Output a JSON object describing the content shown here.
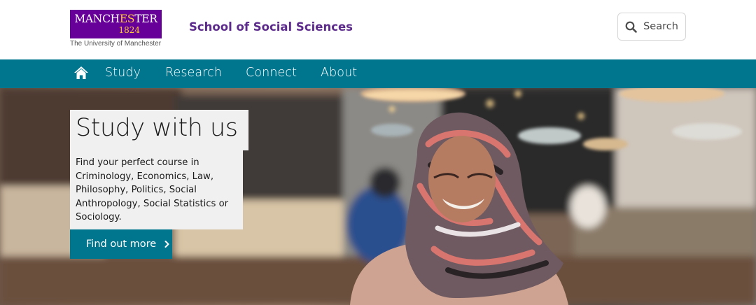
{
  "header": {
    "logo": {
      "word_start": "MANCH",
      "word_highlight": "ES",
      "word_end": "TER",
      "year": "1824",
      "caption": "The University of Manchester"
    },
    "school_title": "School of Social Sciences",
    "search": {
      "label": "Search",
      "icon": "search-icon"
    }
  },
  "nav": {
    "home_icon": "home-icon",
    "items": [
      {
        "label": "Study"
      },
      {
        "label": "Research"
      },
      {
        "label": "Connect"
      },
      {
        "label": "About"
      }
    ]
  },
  "hero": {
    "title": "Study with us",
    "body": "Find your perfect course in Criminology, Economics, Law, Philosophy, Politics, Social Anthropology, Social Statistics or Sociology.",
    "cta": {
      "label": "Find out more",
      "icon": "chevron-right-icon"
    }
  },
  "colors": {
    "brand_purple": "#660099",
    "brand_gold": "#ffcc33",
    "school_title": "#5c2b8c",
    "nav_teal": "#00758e",
    "card_bg": "#f0f0f0"
  }
}
